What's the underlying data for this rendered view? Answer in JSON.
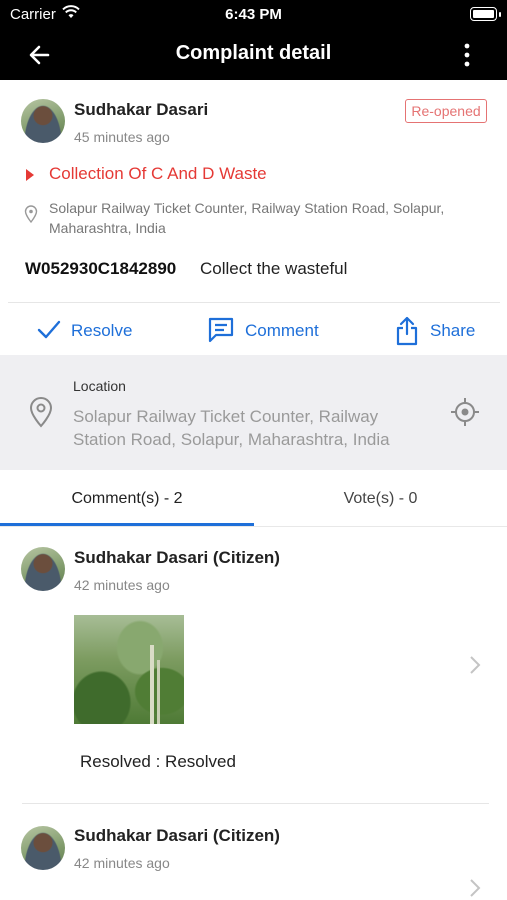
{
  "status_bar": {
    "carrier": "Carrier",
    "time": "6:43 PM"
  },
  "nav": {
    "title": "Complaint detail",
    "back_icon": "back-arrow-icon",
    "menu_icon": "more-vertical-icon"
  },
  "complaint": {
    "author": "Sudhakar Dasari",
    "time": "45 minutes ago",
    "status_badge": "Re-opened",
    "category": "Collection Of C And D Waste",
    "address": "Solapur Railway Ticket Counter, Railway Station Road, Solapur, Maharashtra, India",
    "id": "W052930C1842890",
    "description": "Collect the wasteful"
  },
  "actions": {
    "resolve": "Resolve",
    "comment": "Comment",
    "share": "Share"
  },
  "location": {
    "label": "Location",
    "value": "Solapur Railway Ticket Counter, Railway Station Road, Solapur, Maharashtra, India"
  },
  "tabs": {
    "comments": "Comment(s) - 2",
    "votes": "Vote(s) - 0",
    "active": "comments"
  },
  "comments": [
    {
      "author": "Sudhakar Dasari (Citizen)",
      "time": "42 minutes ago",
      "status": "Resolved : Resolved"
    },
    {
      "author": "Sudhakar Dasari (Citizen)",
      "time": "42 minutes ago"
    }
  ],
  "colors": {
    "accent": "#1e6fd9",
    "alert": "#e53935",
    "badge": "#e57373",
    "header": "#000000"
  }
}
